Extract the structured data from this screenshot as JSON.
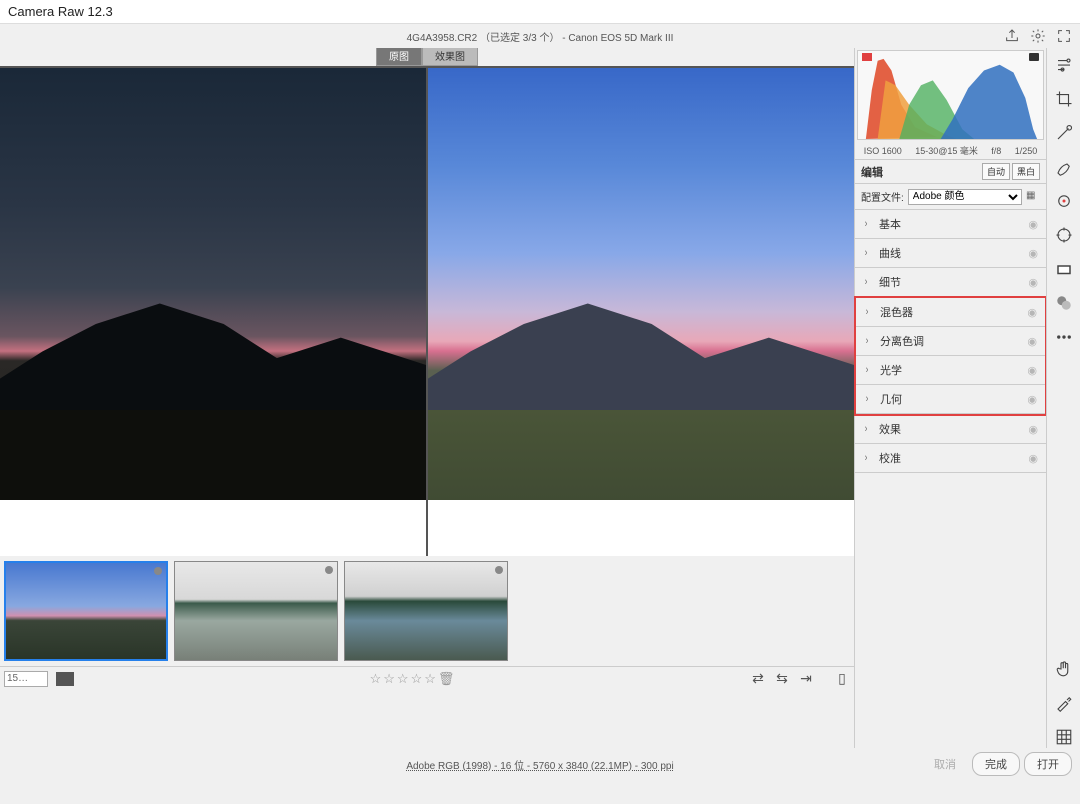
{
  "app_title": "Camera Raw 12.3",
  "file_info": "4G4A3958.CR2 （已选定 3/3 个） - Canon EOS 5D Mark III",
  "compare": {
    "before": "原图",
    "after": "效果图"
  },
  "exif": {
    "iso": "ISO 1600",
    "focal": "15-30@15 毫米",
    "aperture": "f/8",
    "shutter": "1/250"
  },
  "edit": {
    "title": "编辑",
    "auto": "自动",
    "bw": "黑白"
  },
  "profile": {
    "label": "配置文件:",
    "value": "Adobe 颜色"
  },
  "sections": [
    {
      "label": "基本"
    },
    {
      "label": "曲线"
    },
    {
      "label": "细节"
    },
    {
      "label": "混色器"
    },
    {
      "label": "分离色调"
    },
    {
      "label": "光学"
    },
    {
      "label": "几何"
    },
    {
      "label": "效果"
    },
    {
      "label": "校准"
    }
  ],
  "zoom": "15…",
  "image_meta": "Adobe RGB (1998) - 16 位 - 5760 x 3840 (22.1MP) - 300 ppi",
  "buttons": {
    "cancel": "取消",
    "done": "完成",
    "open": "打开"
  }
}
